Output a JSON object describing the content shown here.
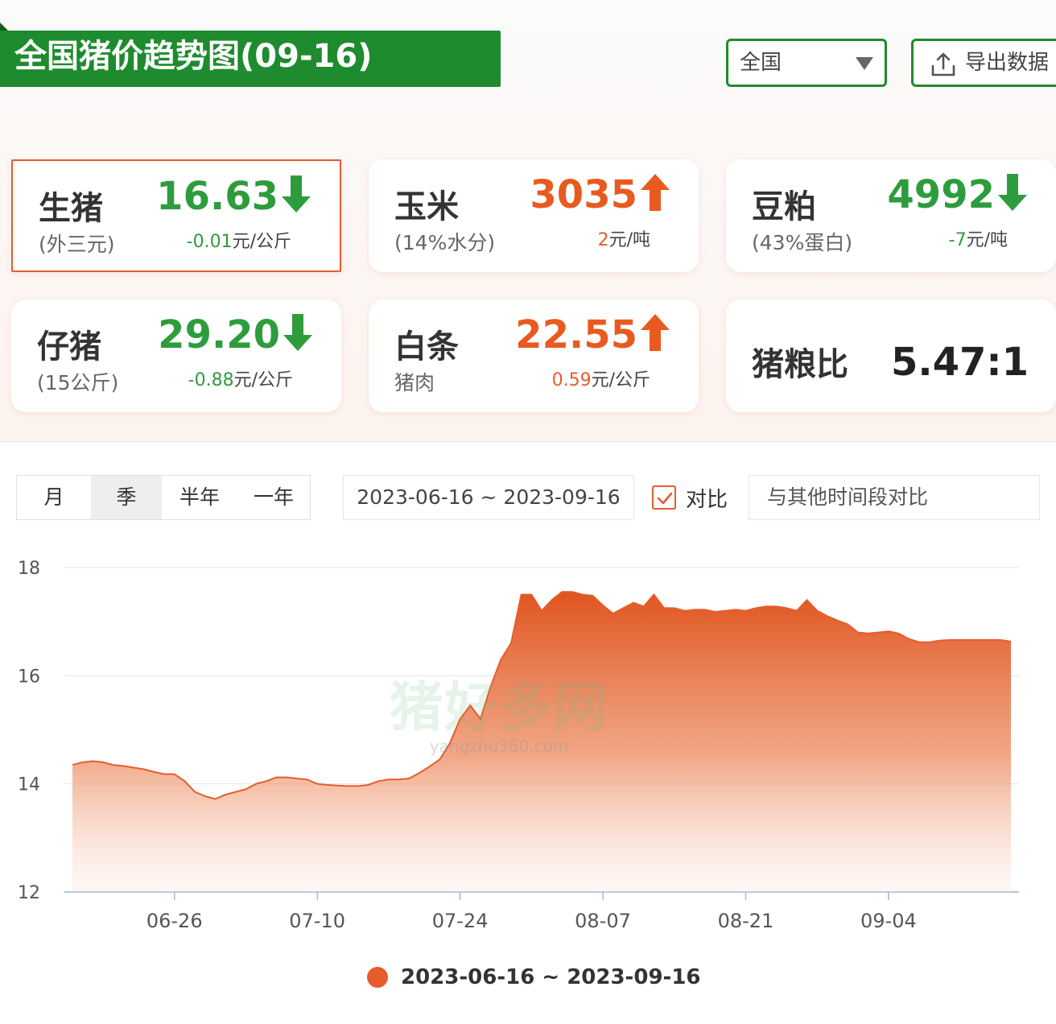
{
  "header": {
    "title": "全国猪价趋势图(09-16)",
    "region": "全国",
    "export_label": "导出数据"
  },
  "cards": [
    {
      "name": "生猪",
      "sub": "(外三元)",
      "value": "16.63",
      "direction": "down",
      "change": "-0.01",
      "unit": "元/公斤"
    },
    {
      "name": "玉米",
      "sub": "(14%水分)",
      "value": "3035",
      "direction": "up",
      "change": "2",
      "unit": "元/吨"
    },
    {
      "name": "豆粕",
      "sub": "(43%蛋白)",
      "value": "4992",
      "direction": "down",
      "change": "-7",
      "unit": "元/吨"
    },
    {
      "name": "仔猪",
      "sub": "(15公斤)",
      "value": "29.20",
      "direction": "down",
      "change": "-0.88",
      "unit": "元/公斤"
    },
    {
      "name": "白条",
      "sub": "猪肉",
      "value": "22.55",
      "direction": "up",
      "change": "0.59",
      "unit": "元/公斤"
    },
    {
      "name": "猪粮比",
      "ratio": "5.47:1"
    }
  ],
  "controls": {
    "periods": [
      "月",
      "季",
      "半年",
      "一年"
    ],
    "active_period": "季",
    "date_range": "2023-06-16 ~ 2023-09-16",
    "compare_checked": true,
    "compare_label": "对比",
    "compare_placeholder": "与其他时间段对比"
  },
  "watermark": {
    "main": "猪好多网",
    "sub": "yangzhu360.com"
  },
  "colors": {
    "brand_green": "#1e8b2e",
    "accent_orange": "#e65c2c",
    "down_green": "#2e9c3c"
  },
  "chart_data": {
    "type": "area",
    "title": "",
    "xlabel": "",
    "ylabel": "",
    "ylim": [
      12,
      18
    ],
    "yticks": [
      12,
      14,
      16,
      18
    ],
    "x_ticks": [
      "06-26",
      "07-10",
      "07-24",
      "08-07",
      "08-21",
      "09-04"
    ],
    "grid": true,
    "legend": "bottom-center",
    "series": [
      {
        "name": "2023-06-16 ~ 2023-09-16",
        "color": "#e65c2c",
        "x": [
          "06-16",
          "06-17",
          "06-18",
          "06-19",
          "06-20",
          "06-21",
          "06-22",
          "06-23",
          "06-24",
          "06-25",
          "06-26",
          "06-27",
          "06-28",
          "06-29",
          "06-30",
          "07-01",
          "07-02",
          "07-03",
          "07-04",
          "07-05",
          "07-06",
          "07-07",
          "07-08",
          "07-09",
          "07-10",
          "07-11",
          "07-12",
          "07-13",
          "07-14",
          "07-15",
          "07-16",
          "07-17",
          "07-18",
          "07-19",
          "07-20",
          "07-21",
          "07-22",
          "07-23",
          "07-24",
          "07-25",
          "07-26",
          "07-27",
          "07-28",
          "07-29",
          "07-30",
          "07-31",
          "08-01",
          "08-02",
          "08-03",
          "08-04",
          "08-05",
          "08-06",
          "08-07",
          "08-08",
          "08-09",
          "08-10",
          "08-11",
          "08-12",
          "08-13",
          "08-14",
          "08-15",
          "08-16",
          "08-17",
          "08-18",
          "08-19",
          "08-20",
          "08-21",
          "08-22",
          "08-23",
          "08-24",
          "08-25",
          "08-26",
          "08-27",
          "08-28",
          "08-29",
          "08-30",
          "08-31",
          "09-01",
          "09-02",
          "09-03",
          "09-04",
          "09-05",
          "09-06",
          "09-07",
          "09-08",
          "09-09",
          "09-10",
          "09-11",
          "09-12",
          "09-13",
          "09-14",
          "09-15",
          "09-16"
        ],
        "values": [
          14.35,
          14.4,
          14.42,
          14.4,
          14.35,
          14.33,
          14.3,
          14.27,
          14.22,
          14.18,
          14.18,
          14.05,
          13.85,
          13.77,
          13.72,
          13.8,
          13.85,
          13.9,
          14.0,
          14.05,
          14.12,
          14.12,
          14.1,
          14.08,
          14.0,
          13.98,
          13.97,
          13.96,
          13.96,
          13.98,
          14.05,
          14.08,
          14.08,
          14.1,
          14.2,
          14.32,
          14.45,
          14.75,
          15.2,
          15.45,
          15.2,
          15.8,
          16.3,
          16.6,
          17.5,
          17.5,
          17.2,
          17.4,
          17.55,
          17.55,
          17.5,
          17.48,
          17.3,
          17.15,
          17.25,
          17.35,
          17.28,
          17.5,
          17.25,
          17.25,
          17.2,
          17.22,
          17.22,
          17.18,
          17.2,
          17.22,
          17.2,
          17.25,
          17.28,
          17.28,
          17.25,
          17.2,
          17.4,
          17.2,
          17.1,
          17.02,
          16.95,
          16.8,
          16.78,
          16.8,
          16.82,
          16.78,
          16.68,
          16.62,
          16.62,
          16.65,
          16.66,
          16.66,
          16.66,
          16.66,
          16.66,
          16.66,
          16.63
        ]
      }
    ]
  }
}
